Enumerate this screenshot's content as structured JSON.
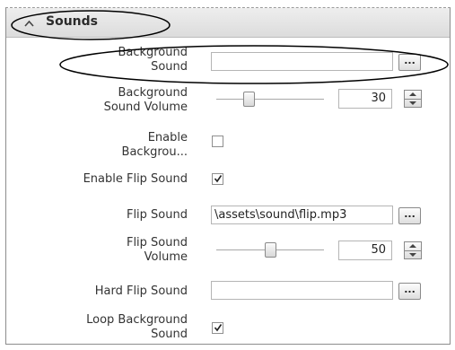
{
  "section": {
    "title": "Sounds",
    "state": "expanded"
  },
  "properties": {
    "background_sound": {
      "label": "Background\nSound",
      "value": "",
      "browse": "..."
    },
    "background_sound_volume": {
      "label": "Background\nSound Volume",
      "value": "30",
      "slider_fraction": 0.3
    },
    "enable_background": {
      "label": "Enable\nBackgrou...",
      "checked": false
    },
    "enable_flip_sound": {
      "label": "Enable Flip Sound",
      "checked": true
    },
    "flip_sound": {
      "label": "Flip Sound",
      "value": "\\assets\\sound\\flip.mp3",
      "browse": "..."
    },
    "flip_sound_volume": {
      "label": "Flip Sound\nVolume",
      "value": "50",
      "slider_fraction": 0.5
    },
    "hard_flip_sound": {
      "label": "Hard Flip Sound",
      "value": "",
      "browse": "..."
    },
    "loop_background_sound": {
      "label": "Loop Background\nSound",
      "checked": true
    }
  },
  "colors": {
    "panel_border": "#8c8c8c",
    "annotation": "#000000"
  },
  "icons": {
    "collapse": "chevron-up-icon",
    "check": "checkmark-icon"
  }
}
